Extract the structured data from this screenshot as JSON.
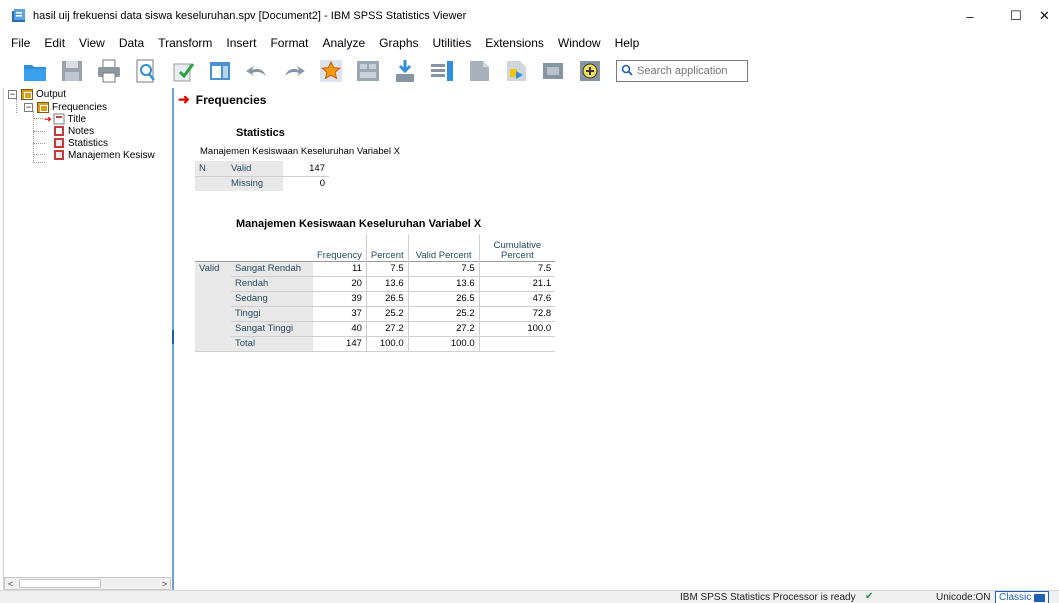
{
  "window": {
    "title": "hasil uij frekuensi data siswa keseluruhan.spv [Document2] - IBM SPSS Statistics Viewer",
    "minimize": "–",
    "maximize": "☐",
    "close": "✕"
  },
  "menu": [
    "File",
    "Edit",
    "View",
    "Data",
    "Transform",
    "Insert",
    "Format",
    "Analyze",
    "Graphs",
    "Utilities",
    "Extensions",
    "Window",
    "Help"
  ],
  "toolbar": {
    "icons": [
      "open-icon",
      "save-icon",
      "print-icon",
      "print-preview-icon",
      "export-icon",
      "recall-dialog-icon",
      "undo-icon",
      "redo-icon",
      "goto-case-icon",
      "goto-variable-icon",
      "insert-cases-icon",
      "insert-variable-icon",
      "split-file-icon",
      "select-cases-icon",
      "value-labels-icon",
      "use-sets-icon"
    ],
    "search_placeholder": "Search application"
  },
  "outline": {
    "root": "Output",
    "group": "Frequencies",
    "items": [
      "Title",
      "Notes",
      "Statistics",
      "Manajemen Kesisw"
    ],
    "toggle_open": "−"
  },
  "content": {
    "heading": "Frequencies",
    "statistics": {
      "title": "Statistics",
      "variable": "Manajemen Kesiswaan Keseluruhan Variabel X",
      "n_label": "N",
      "rows": [
        {
          "label": "Valid",
          "value": "147"
        },
        {
          "label": "Missing",
          "value": "0"
        }
      ]
    },
    "frequency_table": {
      "title": "Manajemen Kesiswaan Keseluruhan Variabel X",
      "headers": [
        "Frequency",
        "Percent",
        "Valid Percent",
        "Cumulative Percent"
      ],
      "group_label": "Valid",
      "rows": [
        {
          "label": "Sangat Rendah",
          "frequency": "11",
          "percent": "7.5",
          "valid_percent": "7.5",
          "cumulative": "7.5"
        },
        {
          "label": "Rendah",
          "frequency": "20",
          "percent": "13.6",
          "valid_percent": "13.6",
          "cumulative": "21.1"
        },
        {
          "label": "Sedang",
          "frequency": "39",
          "percent": "26.5",
          "valid_percent": "26.5",
          "cumulative": "47.6"
        },
        {
          "label": "Tinggi",
          "frequency": "37",
          "percent": "25.2",
          "valid_percent": "25.2",
          "cumulative": "72.8"
        },
        {
          "label": "Sangat Tinggi",
          "frequency": "40",
          "percent": "27.2",
          "valid_percent": "27.2",
          "cumulative": "100.0"
        },
        {
          "label": "Total",
          "frequency": "147",
          "percent": "100.0",
          "valid_percent": "100.0",
          "cumulative": ""
        }
      ]
    }
  },
  "status": {
    "processor": "IBM SPSS Statistics Processor is ready",
    "unicode": "Unicode:ON",
    "mode": "Classic"
  }
}
